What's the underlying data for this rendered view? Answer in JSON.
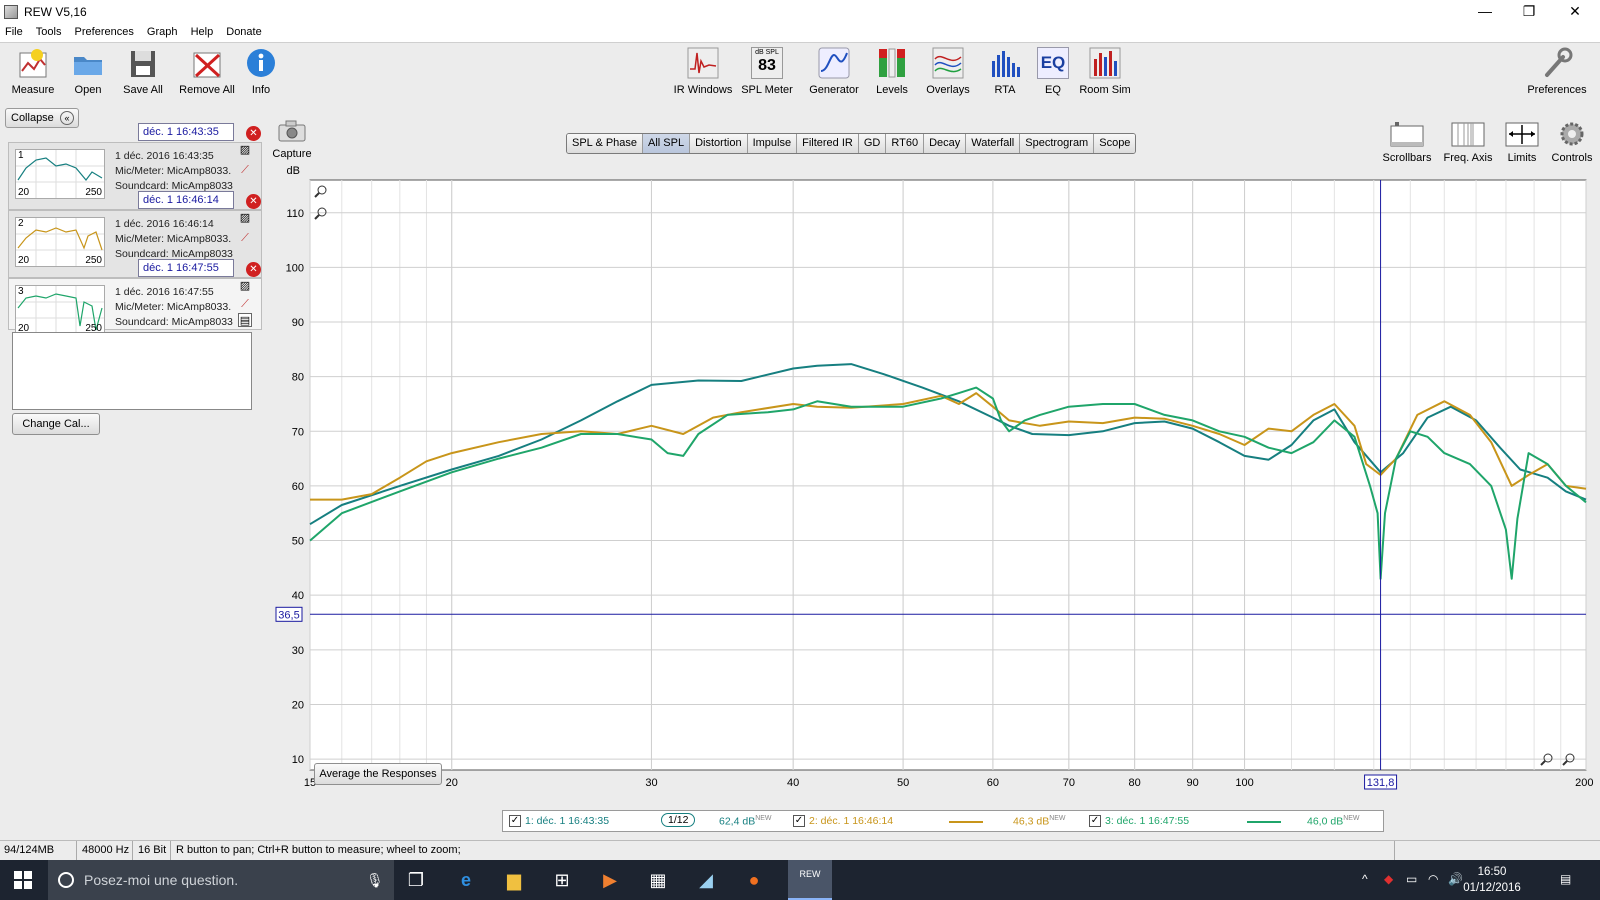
{
  "window": {
    "title": "REW V5,16",
    "minimize": "—",
    "maximize": "❐",
    "close": "✕"
  },
  "menu": [
    "File",
    "Tools",
    "Preferences",
    "Graph",
    "Help",
    "Donate"
  ],
  "toolbar": {
    "measure": "Measure",
    "open": "Open",
    "save_all": "Save All",
    "remove_all": "Remove All",
    "info": "Info",
    "ir_windows": "IR Windows",
    "spl_meter": "SPL Meter",
    "spl_meter_unit": "dB SPL",
    "spl_meter_value": "83",
    "generator": "Generator",
    "levels": "Levels",
    "overlays": "Overlays",
    "rta": "RTA",
    "eq": "EQ",
    "eq_icon_text": "EQ",
    "room_sim": "Room Sim",
    "preferences": "Preferences"
  },
  "left_panel": {
    "collapse": "Collapse",
    "measurements": [
      {
        "name": "déc. 1 16:43:35",
        "num": "1",
        "line1": "1 déc. 2016 16:43:35",
        "line2": "Mic/Meter: MicAmp8033.",
        "line3": "Soundcard: MicAmp8033",
        "axis_min": "20",
        "axis_max": "250",
        "color": "#167f80"
      },
      {
        "name": "déc. 1 16:46:14",
        "num": "2",
        "line1": "1 déc. 2016 16:46:14",
        "line2": "Mic/Meter: MicAmp8033.",
        "line3": "Soundcard: MicAmp8033",
        "axis_min": "20",
        "axis_max": "250",
        "color": "#c8951a"
      },
      {
        "name": "déc. 1 16:47:55",
        "num": "3",
        "line1": "1 déc. 2016 16:47:55",
        "line2": "Mic/Meter: MicAmp8033.",
        "line3": "Soundcard: MicAmp8033",
        "axis_min": "20",
        "axis_max": "250",
        "color": "#1fa56a"
      }
    ],
    "change_cal": "Change Cal..."
  },
  "capture": "Capture",
  "graph_tabs": [
    "SPL & Phase",
    "All SPL",
    "Distortion",
    "Impulse",
    "Filtered IR",
    "GD",
    "RT60",
    "Decay",
    "Waterfall",
    "Spectrogram",
    "Scope"
  ],
  "active_tab": "All SPL",
  "graph_controls": {
    "scrollbars": "Scrollbars",
    "freq_axis": "Freq. Axis",
    "limits": "Limits",
    "controls": "Controls"
  },
  "average_button": "Average the Responses",
  "chart_data": {
    "type": "line",
    "ylabel": "dB",
    "xscale": "log",
    "xlim": [
      15,
      200
    ],
    "ylim": [
      8,
      116
    ],
    "yticks": [
      10,
      20,
      30,
      40,
      50,
      60,
      70,
      80,
      90,
      100,
      110
    ],
    "xticks": [
      15,
      20,
      30,
      40,
      50,
      60,
      70,
      80,
      90,
      100,
      200
    ],
    "xtick_labels": [
      "15",
      "20",
      "30",
      "40",
      "50",
      "60",
      "70",
      "80",
      "90",
      "100",
      "200 Hz"
    ],
    "grid": true,
    "cursor": {
      "x": 131.8,
      "y": 36.5,
      "x_label": "131,8",
      "y_label": "36,5"
    },
    "series": [
      {
        "name": "1: déc. 1 16:43:35",
        "color": "#167f80",
        "x": [
          15,
          16,
          18,
          20,
          22,
          24,
          26,
          28,
          30,
          33,
          36,
          40,
          42,
          45,
          48,
          52,
          56,
          60,
          62,
          65,
          70,
          75,
          80,
          85,
          90,
          95,
          100,
          105,
          110,
          115,
          120,
          125,
          131.8,
          138,
          145,
          152,
          160,
          168,
          175,
          185,
          192,
          200
        ],
        "y": [
          53,
          56.5,
          60,
          63,
          65.5,
          68.5,
          72,
          75.5,
          78.5,
          79.3,
          79.2,
          81.5,
          82,
          82.3,
          80.5,
          78,
          75.5,
          72.5,
          71,
          69.5,
          69.3,
          70,
          71.5,
          71.8,
          70.5,
          68,
          65.5,
          64.8,
          67.5,
          72,
          74,
          68,
          62.5,
          66,
          72.5,
          74.5,
          72,
          67,
          63,
          61.5,
          59,
          57.5
        ]
      },
      {
        "name": "2: déc. 1 16:46:14",
        "color": "#c8951a",
        "x": [
          15,
          16,
          17,
          18,
          19,
          20,
          22,
          24,
          26,
          28,
          30,
          32,
          34,
          36,
          40,
          42,
          45,
          50,
          54,
          56,
          58,
          60,
          62,
          66,
          70,
          75,
          80,
          85,
          90,
          95,
          100,
          105,
          110,
          115,
          120,
          125,
          128,
          131.8,
          136,
          142,
          150,
          158,
          165,
          172,
          178,
          185,
          192,
          200
        ],
        "y": [
          57.5,
          57.5,
          58.5,
          61.5,
          64.5,
          66,
          68,
          69.5,
          70,
          69.5,
          71,
          69.5,
          72.5,
          73.5,
          75,
          74.5,
          74.3,
          75,
          76.5,
          75,
          77,
          74.5,
          72,
          71,
          71.8,
          71.5,
          72.5,
          72.3,
          71,
          69.5,
          67.5,
          70.5,
          70,
          73,
          75,
          71,
          64,
          62,
          65,
          73,
          75.5,
          73,
          68,
          60,
          62,
          64,
          60,
          59.5
        ]
      },
      {
        "name": "3: déc. 1 16:47:55",
        "color": "#1fa56a",
        "x": [
          15,
          16,
          18,
          20,
          22,
          24,
          26,
          28,
          30,
          31,
          32,
          33,
          35,
          38,
          40,
          42,
          45,
          50,
          54,
          56,
          58,
          60,
          61,
          62,
          64,
          66,
          70,
          75,
          80,
          85,
          90,
          95,
          100,
          105,
          110,
          115,
          120,
          125,
          129,
          131,
          131.8,
          133,
          136,
          140,
          145,
          150,
          158,
          165,
          170,
          172,
          174,
          178,
          185,
          192,
          200
        ],
        "y": [
          50,
          55,
          59,
          62.5,
          65,
          67,
          69.5,
          69.5,
          68.5,
          66,
          65.5,
          69.5,
          73,
          73.5,
          74,
          75.5,
          74.5,
          74.5,
          76,
          77,
          78,
          76,
          72,
          70,
          72,
          73,
          74.5,
          75,
          75,
          73,
          72,
          70,
          69,
          67,
          66,
          68,
          72,
          69,
          60,
          55,
          43,
          55,
          65,
          70,
          69,
          66,
          64,
          60,
          52,
          43,
          54,
          66,
          64,
          60,
          57
        ]
      }
    ]
  },
  "legend": {
    "items": [
      {
        "label": "1: déc. 1 16:43:35",
        "smoothing": "1/12",
        "level": "62,4 dB",
        "tag": "NEW",
        "color": "#167f80"
      },
      {
        "label": "2: déc. 1 16:46:14",
        "level": "46,3 dB",
        "tag": "NEW",
        "color": "#c8951a"
      },
      {
        "label": "3: déc. 1 16:47:55",
        "level": "46,0 dB",
        "tag": "NEW",
        "color": "#1fa56a"
      }
    ]
  },
  "status": {
    "memory": "94/124MB",
    "rate": "48000 Hz",
    "bits": "16 Bit",
    "hint": "R button to pan; Ctrl+R button to measure; wheel to zoom;"
  },
  "taskbar": {
    "search_placeholder": "Posez-moi une question.",
    "time": "16:50",
    "date": "01/12/2016",
    "rew_label": "REW"
  }
}
